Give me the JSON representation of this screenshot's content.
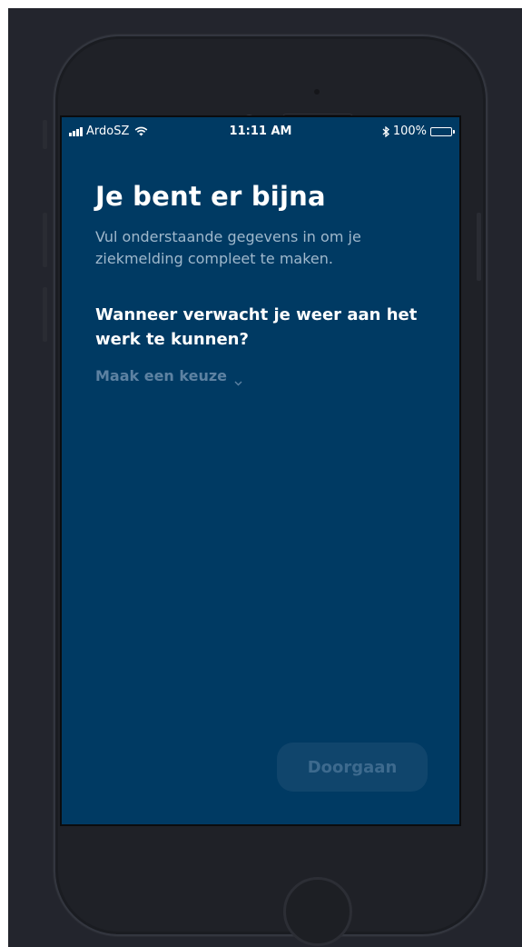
{
  "statusbar": {
    "carrier": "ArdoSZ",
    "time": "11:11 AM",
    "bluetooth_symbol": "∗",
    "battery": "100%"
  },
  "screen": {
    "title": "Je bent er bijna",
    "subtitle": "Vul onderstaande gegevens in om je ziekmelding compleet te maken.",
    "question": "Wanneer verwacht je weer aan het werk te kunnen?",
    "select": {
      "placeholder": "Maak een keuze"
    },
    "continue_label": "Doorgaan"
  },
  "colors": {
    "screen_bg": "#003a63",
    "title": "#ffffff",
    "subtitle": "#9fb8cc",
    "select_text": "#5d82a2",
    "button_bg_disabled": "#10456c",
    "button_text_disabled": "#3d6a8e"
  },
  "icons": {
    "signal": "signal-bars-icon",
    "wifi": "wifi-icon",
    "bluetooth": "bluetooth-icon",
    "battery": "battery-icon",
    "chevron": "chevron-down-icon"
  }
}
